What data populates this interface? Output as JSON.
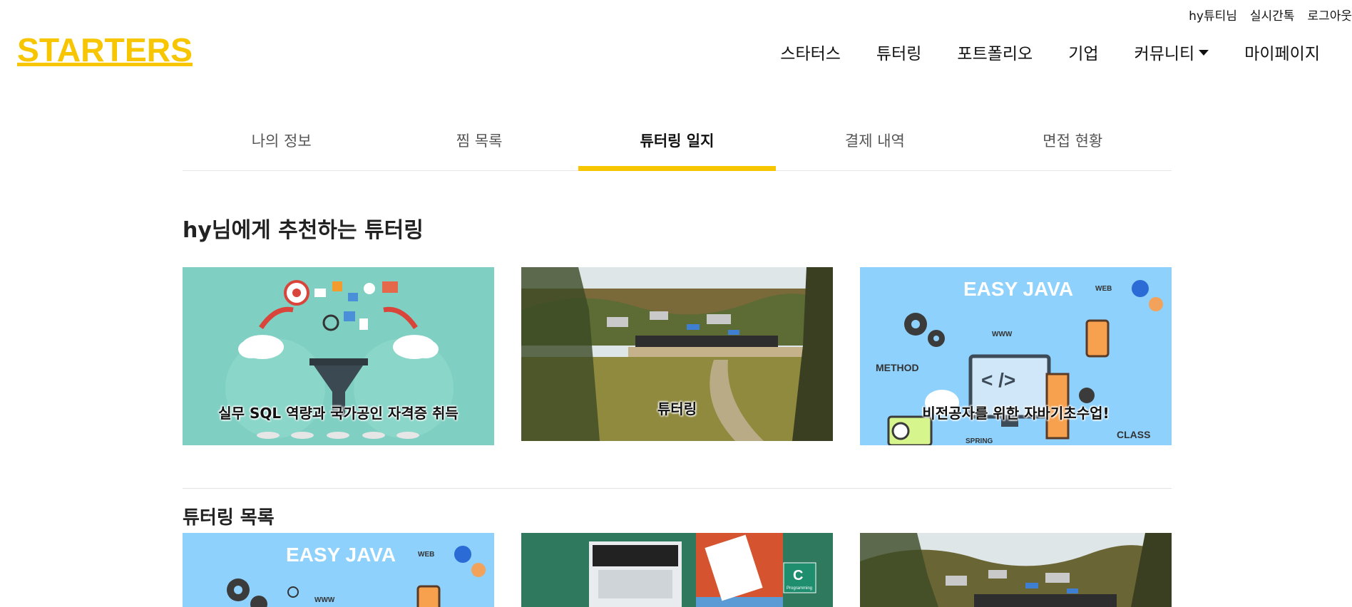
{
  "topbar": {
    "user": "hy튜티님",
    "chat": "실시간톡",
    "logout": "로그아웃"
  },
  "logo": {
    "text": "STARTERS",
    "color": "#f7c600"
  },
  "nav": {
    "starters": "스타터스",
    "tutoring": "튜터링",
    "portfolio": "포트폴리오",
    "company": "기업",
    "community": "커뮤니티",
    "mypage": "마이페이지"
  },
  "tabs": {
    "myinfo": "나의 정보",
    "wishlist": "찜 목록",
    "journal": "튜터링 일지",
    "payment": "결제 내역",
    "interview": "면접 현황"
  },
  "recommend": {
    "title": "hy님에게 추천하는 튜터링",
    "cards": [
      {
        "label": "실무 SQL 역량과 국가공인 자격증 취득"
      },
      {
        "label": "튜터링"
      },
      {
        "label": "비전공자를 위한 자바기초수업!",
        "image_text": {
          "title": "EASY JAVA",
          "web": "WEB",
          "www": "WWW",
          "method": "METHOD",
          "code": "<  />",
          "class": "CLASS",
          "spring": "SPRING"
        }
      }
    ]
  },
  "list": {
    "title": "튜터링 목록",
    "cards": [
      {
        "image_text": {
          "title": "EASY JAVA",
          "web": "WEB",
          "www": "WWW"
        }
      },
      {
        "image_text": {
          "badge": "C",
          "badge_sub": "Programming"
        }
      },
      {}
    ]
  },
  "colors": {
    "accent": "#f7c600",
    "sql_bg": "#7fcfc3",
    "java_bg": "#8ed1fc"
  }
}
